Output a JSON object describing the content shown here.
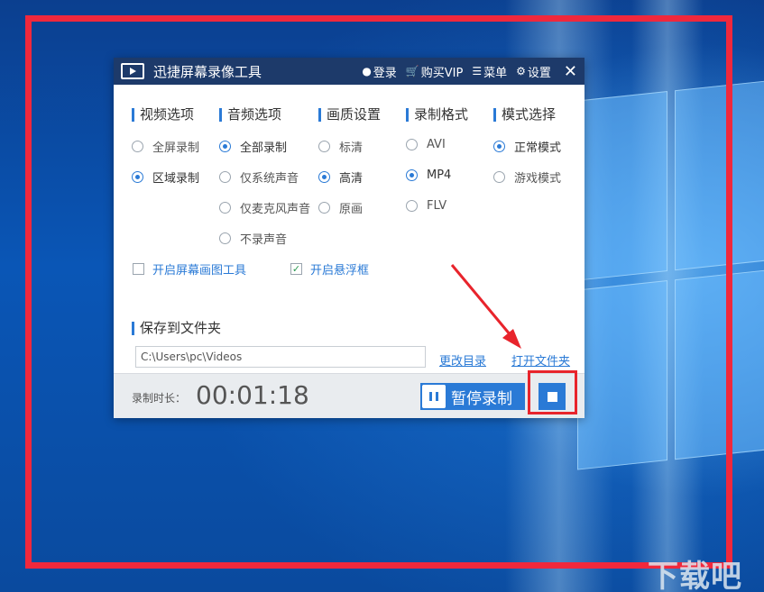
{
  "app": {
    "title": "迅捷屏幕录像工具",
    "toolbar": {
      "login": "登录",
      "buy_vip": "购买VIP",
      "menu": "菜单",
      "settings": "设置"
    }
  },
  "sections": {
    "video": "视频选项",
    "audio": "音频选项",
    "quality": "画质设置",
    "format": "录制格式",
    "mode": "模式选择"
  },
  "video_options": [
    "全屏录制",
    "区域录制"
  ],
  "audio_options": [
    "全部录制",
    "仅系统声音",
    "仅麦克风声音",
    "不录声音"
  ],
  "quality_options": [
    "标清",
    "高清",
    "原画"
  ],
  "format_options": [
    "AVI",
    "MP4",
    "FLV"
  ],
  "mode_options": [
    "正常模式",
    "游戏模式"
  ],
  "selected": {
    "video": "区域录制",
    "audio": "全部录制",
    "quality": "高清",
    "format": "MP4",
    "mode": "正常模式"
  },
  "checkboxes": {
    "drawing_tool": {
      "label": "开启屏幕画图工具",
      "checked": false
    },
    "floating_box": {
      "label": "开启悬浮框",
      "checked": true
    }
  },
  "save": {
    "title": "保存到文件夹",
    "path": "C:\\Users\\pc\\Videos",
    "change_dir": "更改目录",
    "open_folder": "打开文件夹"
  },
  "footer": {
    "duration_label": "录制时长：",
    "duration_value": "00:01:18",
    "pause_label": "暂停录制"
  },
  "colors": {
    "accent": "#2a7ad6",
    "titlebar": "#1d3a6a",
    "record_frame": "#f0283c",
    "highlight": "#e8242c"
  },
  "watermark": "下载吧"
}
